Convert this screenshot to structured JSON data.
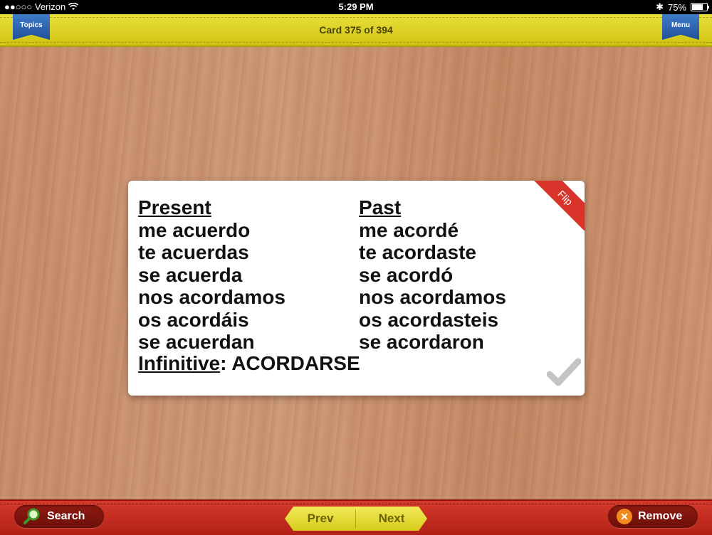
{
  "status_bar": {
    "carrier": "●●○○○ Verizon",
    "time": "5:29 PM",
    "battery": "75%",
    "battery_level": 0.75
  },
  "header": {
    "topics_label": "Topics",
    "card_counter": "Card 375 of 394",
    "menu_label": "Menu"
  },
  "card": {
    "flip_label": "Flip",
    "present": {
      "heading": "Present",
      "forms": [
        "me acuerdo",
        "te acuerdas",
        "se acuerda",
        "nos acordamos",
        "os acordáis",
        "se acuerdan"
      ]
    },
    "past": {
      "heading": "Past",
      "forms": [
        "me acordé",
        "te acordaste",
        "se acordó",
        "nos acordamos",
        "os acordasteis",
        "se acordaron"
      ]
    },
    "infinitive_label": "Infinitive",
    "infinitive_value": ": ACORDARSE"
  },
  "footer": {
    "search_label": "Search",
    "prev_label": "Prev",
    "next_label": "Next",
    "remove_label": "Remove"
  },
  "colors": {
    "header_yellow": "#dcd124",
    "footer_red": "#c52d20",
    "ribbon_blue": "#2f63b0",
    "flip_red": "#d9342b",
    "remove_orange": "#f28a1e"
  }
}
